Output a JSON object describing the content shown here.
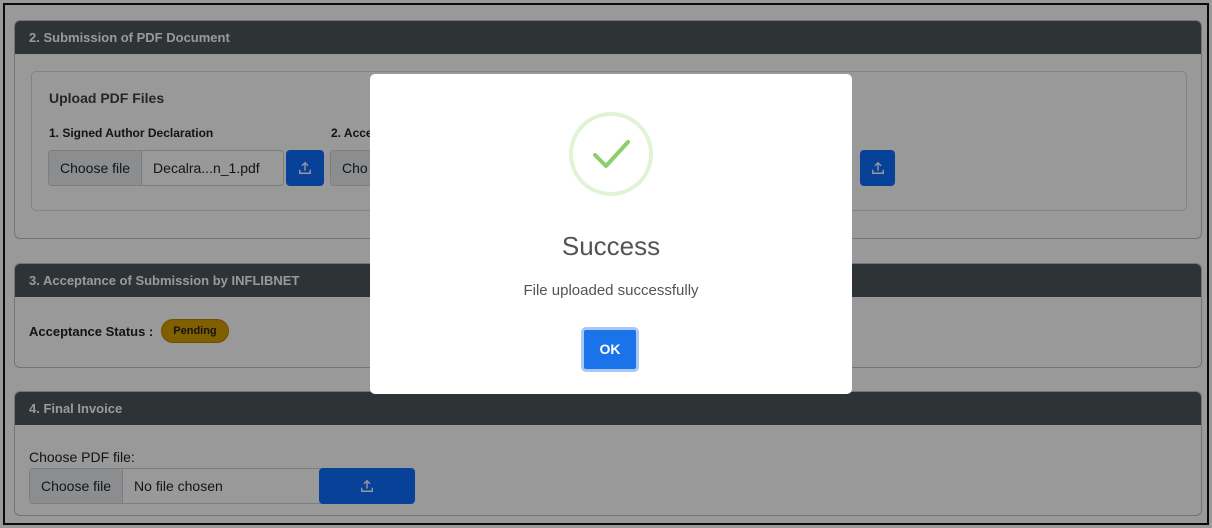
{
  "sections": {
    "submission": {
      "title": "2. Submission of PDF Document",
      "box_title": "Upload PDF Files",
      "field1": {
        "label": "1. Signed Author Declaration",
        "button": "Choose file",
        "file_name": "Decalra...n_1.pdf"
      },
      "field2": {
        "label": "2. Acce",
        "button": "Cho"
      }
    },
    "acceptance": {
      "title": "3. Acceptance of Submission by INFLIBNET",
      "status_label": "Acceptance Status :",
      "status_badge": "Pending"
    },
    "invoice": {
      "title": "4. Final Invoice",
      "choose_label": "Choose PDF file:",
      "button": "Choose file",
      "file_name": "No file chosen"
    }
  },
  "modal": {
    "title": "Success",
    "message": "File uploaded successfully",
    "ok_label": "OK"
  },
  "icons": {
    "upload": "upload-icon",
    "check": "check-icon"
  },
  "colors": {
    "primary": "#0d6efd",
    "header": "#4e555b",
    "badge": "#d69e00",
    "success": "#a5dc86"
  }
}
